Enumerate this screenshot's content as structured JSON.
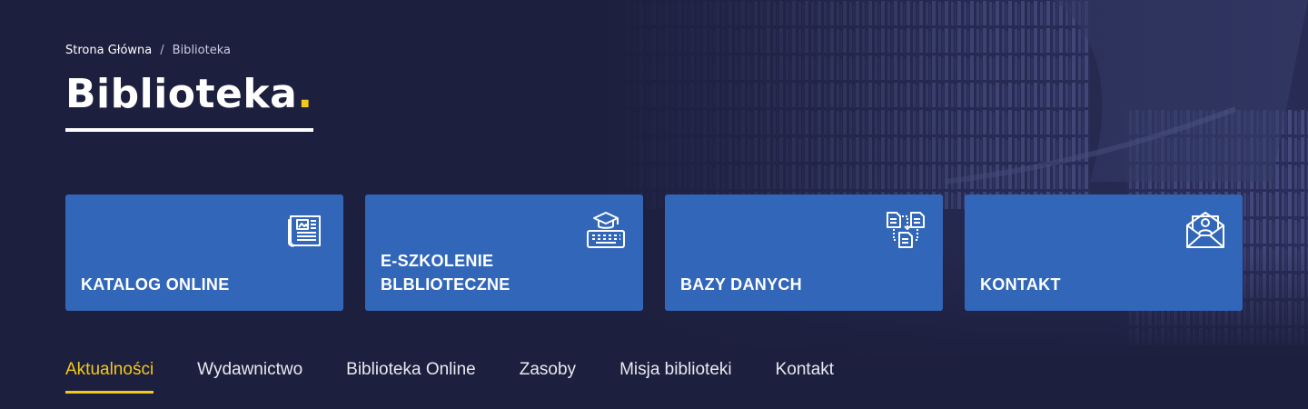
{
  "colors": {
    "background": "#1d1f3e",
    "card": "#3266b9",
    "accent": "#f2c81a",
    "text": "#ffffff"
  },
  "breadcrumb": {
    "home": "Strona Główna",
    "separator": "/",
    "current": "Biblioteka"
  },
  "page": {
    "title": "Biblioteka",
    "title_dot": "."
  },
  "cards": [
    {
      "label": "KATALOG ONLINE",
      "icon": "newspaper-icon"
    },
    {
      "label": "E-SZKOLENIE\nBLBLIOTECZNE",
      "icon": "graduation-keyboard-icon"
    },
    {
      "label": "BAZY DANYCH",
      "icon": "documents-exchange-icon"
    },
    {
      "label": "KONTAKT",
      "icon": "mail-contact-icon"
    }
  ],
  "tabs": [
    {
      "label": "Aktualności",
      "active": true
    },
    {
      "label": "Wydawnictwo",
      "active": false
    },
    {
      "label": "Biblioteka Online",
      "active": false
    },
    {
      "label": "Zasoby",
      "active": false
    },
    {
      "label": "Misja biblioteki",
      "active": false
    },
    {
      "label": "Kontakt",
      "active": false
    }
  ]
}
